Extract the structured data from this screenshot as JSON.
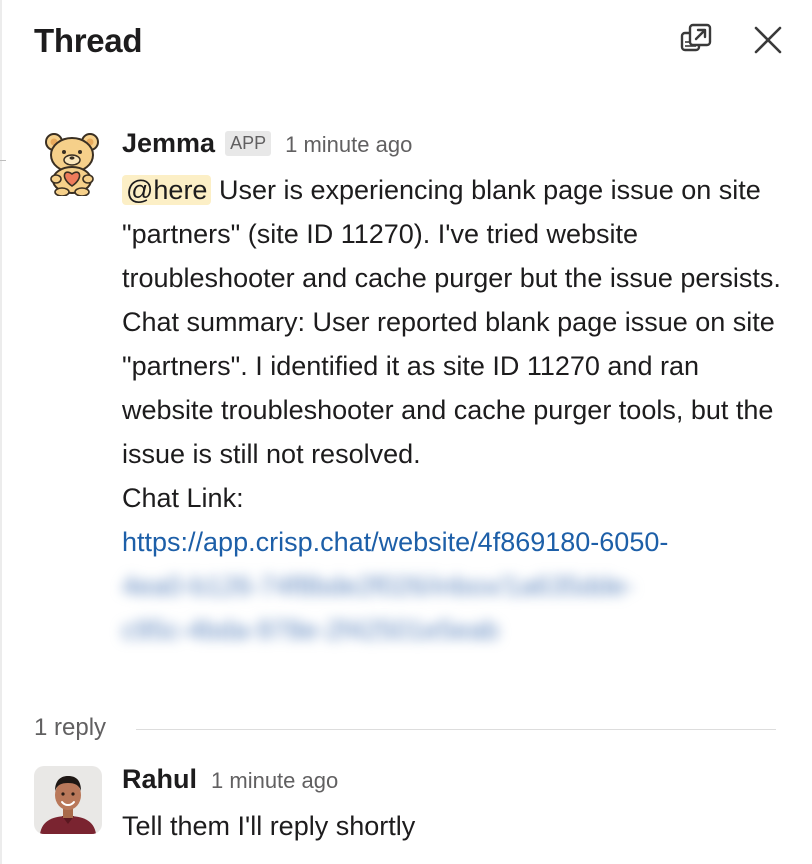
{
  "header": {
    "title": "Thread",
    "popout_icon": "popout-window-icon",
    "close_icon": "close-icon"
  },
  "message1": {
    "author": "Jemma",
    "badge": "APP",
    "time": "1 minute ago",
    "mention": "@here",
    "text_1": " User is experiencing blank page issue on site \"partners\" (site ID 11270). I've tried website troubleshooter and cache purger but the issue persists.",
    "text_2": "Chat summary: User reported blank page issue on site \"partners\". I identified it as site ID 11270 and ran website troubleshooter and cache purger tools, but the issue is still not resolved.",
    "text_3": "Chat Link:",
    "link": "https://app.crisp.chat/website/4f869180-6050-",
    "link_blurred_1": "4ea0-b126-74f8bde2f026/inbox/1a635dde-",
    "link_blurred_2": "c95c-4bda-978e-2f42501e5eab"
  },
  "replies": {
    "label": "1 reply"
  },
  "message2": {
    "author": "Rahul",
    "time": "1 minute ago",
    "text": "Tell them I'll reply shortly"
  },
  "colors": {
    "link": "#1d5fa8",
    "mention_bg": "#fcefc6",
    "muted": "#616061"
  }
}
